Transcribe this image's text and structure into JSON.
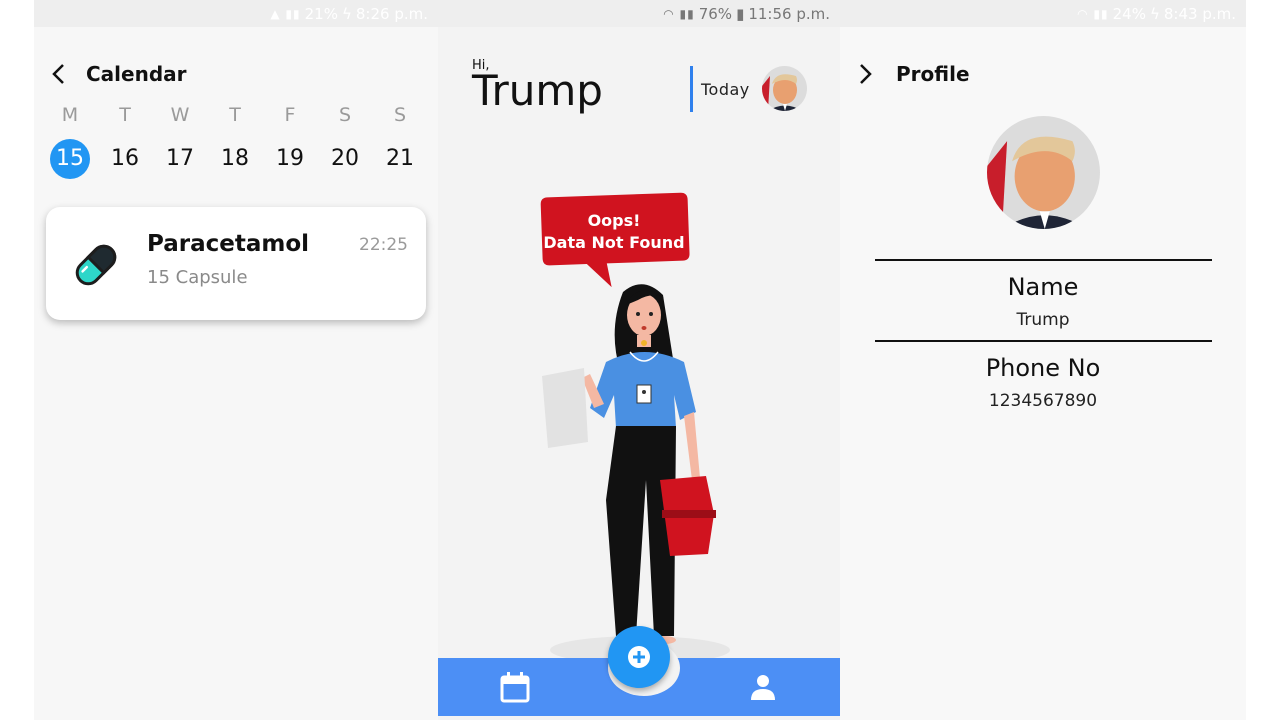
{
  "calendar_screen": {
    "status": {
      "battery": "21%",
      "time": "8:26 p.m."
    },
    "title": "Calendar",
    "weekdays": [
      "M",
      "T",
      "W",
      "T",
      "F",
      "S",
      "S"
    ],
    "dates": [
      "15",
      "16",
      "17",
      "18",
      "19",
      "20",
      "21"
    ],
    "selected_date": "15",
    "medicine": {
      "name": "Paracetamol",
      "dose": "15 Capsule",
      "time": "22:25"
    },
    "colors": {
      "accent": "#2196f3",
      "pill": "#2ed6c9"
    }
  },
  "home_screen": {
    "status": {
      "battery": "76%",
      "time": "11:56 p.m."
    },
    "greeting": "Hi,",
    "user_name": "Trump",
    "today_label": "Today",
    "empty_message": {
      "line1": "Oops!",
      "line2": "Data Not Found"
    },
    "nav": {
      "calendar_icon": "calendar-icon",
      "add_icon": "plus-icon",
      "profile_icon": "person-icon"
    },
    "colors": {
      "bar": "#4c8ff5",
      "fab": "#2196f3",
      "bubble": "#d0131f"
    }
  },
  "profile_screen": {
    "status": {
      "battery": "24%",
      "time": "8:43 p.m."
    },
    "title": "Profile",
    "name_label": "Name",
    "name_value": "Trump",
    "phone_label": "Phone No",
    "phone_value": "1234567890"
  }
}
